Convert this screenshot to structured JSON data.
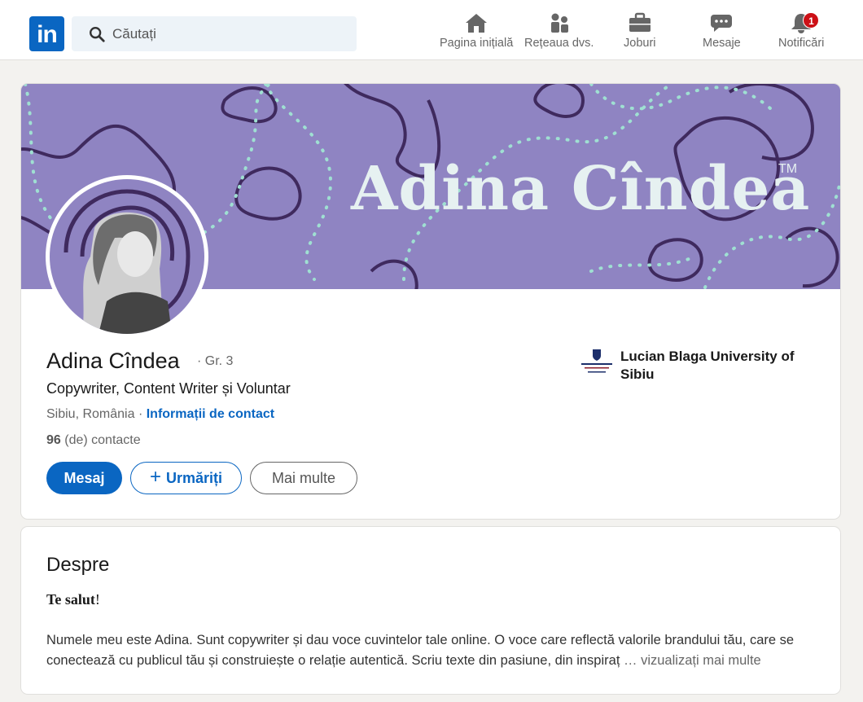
{
  "nav": {
    "logo_text": "in",
    "search_placeholder": "Căutați",
    "items": [
      {
        "label": "Pagina inițială",
        "icon": "home-icon"
      },
      {
        "label": "Rețeaua dvs.",
        "icon": "network-icon"
      },
      {
        "label": "Joburi",
        "icon": "briefcase-icon"
      },
      {
        "label": "Mesaje",
        "icon": "messaging-icon"
      },
      {
        "label": "Notificări",
        "icon": "bell-icon",
        "badge": "1"
      }
    ]
  },
  "profile": {
    "banner_name": "Adina Cîndea",
    "banner_tm": "TM",
    "name": "Adina Cîndea",
    "degree": "· Gr. 3",
    "headline": "Copywriter, Content Writer și Voluntar",
    "location": "Sibiu, România",
    "location_sep": " · ",
    "contact_link": "Informații de contact",
    "connections_count": "96",
    "connections_label": " (de) contacte",
    "buttons": {
      "message": "Mesaj",
      "follow": "Urmăriți",
      "more": "Mai multe"
    },
    "education": "Lucian Blaga University of Sibiu"
  },
  "about": {
    "title": "Despre",
    "greeting_bold": "Te salut",
    "greeting_rest": "!",
    "text": "Numele meu este Adina. Sunt copywriter și dau voce cuvintelor tale online. O voce care reflectă valorile brandului tău, care se conectează cu publicul tău și construiește o relație autentică. Scriu texte din pasiune, din inspiraț",
    "see_more": " … vizualizați mai multe"
  },
  "colors": {
    "brand": "#0a66c2",
    "banner": "#8f84c2",
    "badge": "#cc1016"
  }
}
